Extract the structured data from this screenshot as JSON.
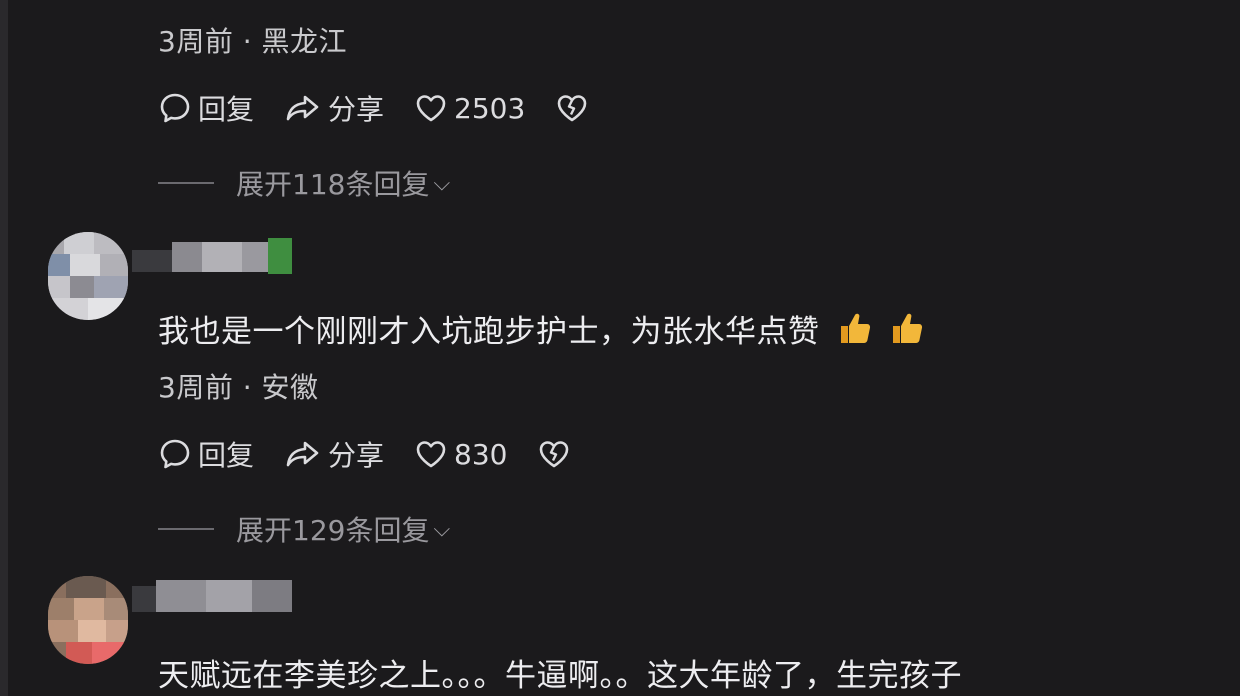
{
  "comments": [
    {
      "time": "3周前",
      "location": "黑龙江",
      "actions": {
        "reply": "回复",
        "share": "分享",
        "likes": "2503"
      },
      "expand": "展开118条回复"
    },
    {
      "text": "我也是一个刚刚才入坑跑步护士，为张水华点赞",
      "time": "3周前",
      "location": "安徽",
      "actions": {
        "reply": "回复",
        "share": "分享",
        "likes": "830"
      },
      "expand": "展开129条回复"
    },
    {
      "text": "天赋远在李美珍之上。。。牛逼啊。。这大年龄了，生完孩子"
    }
  ],
  "separator": "·",
  "colors": {
    "background": "#1b1a1c",
    "thumbs_up": "#f2b73a"
  },
  "icons": [
    "comment-icon",
    "share-icon",
    "heart-icon",
    "broken-heart-icon",
    "thumbs-up-icon",
    "chevron-down-icon"
  ]
}
